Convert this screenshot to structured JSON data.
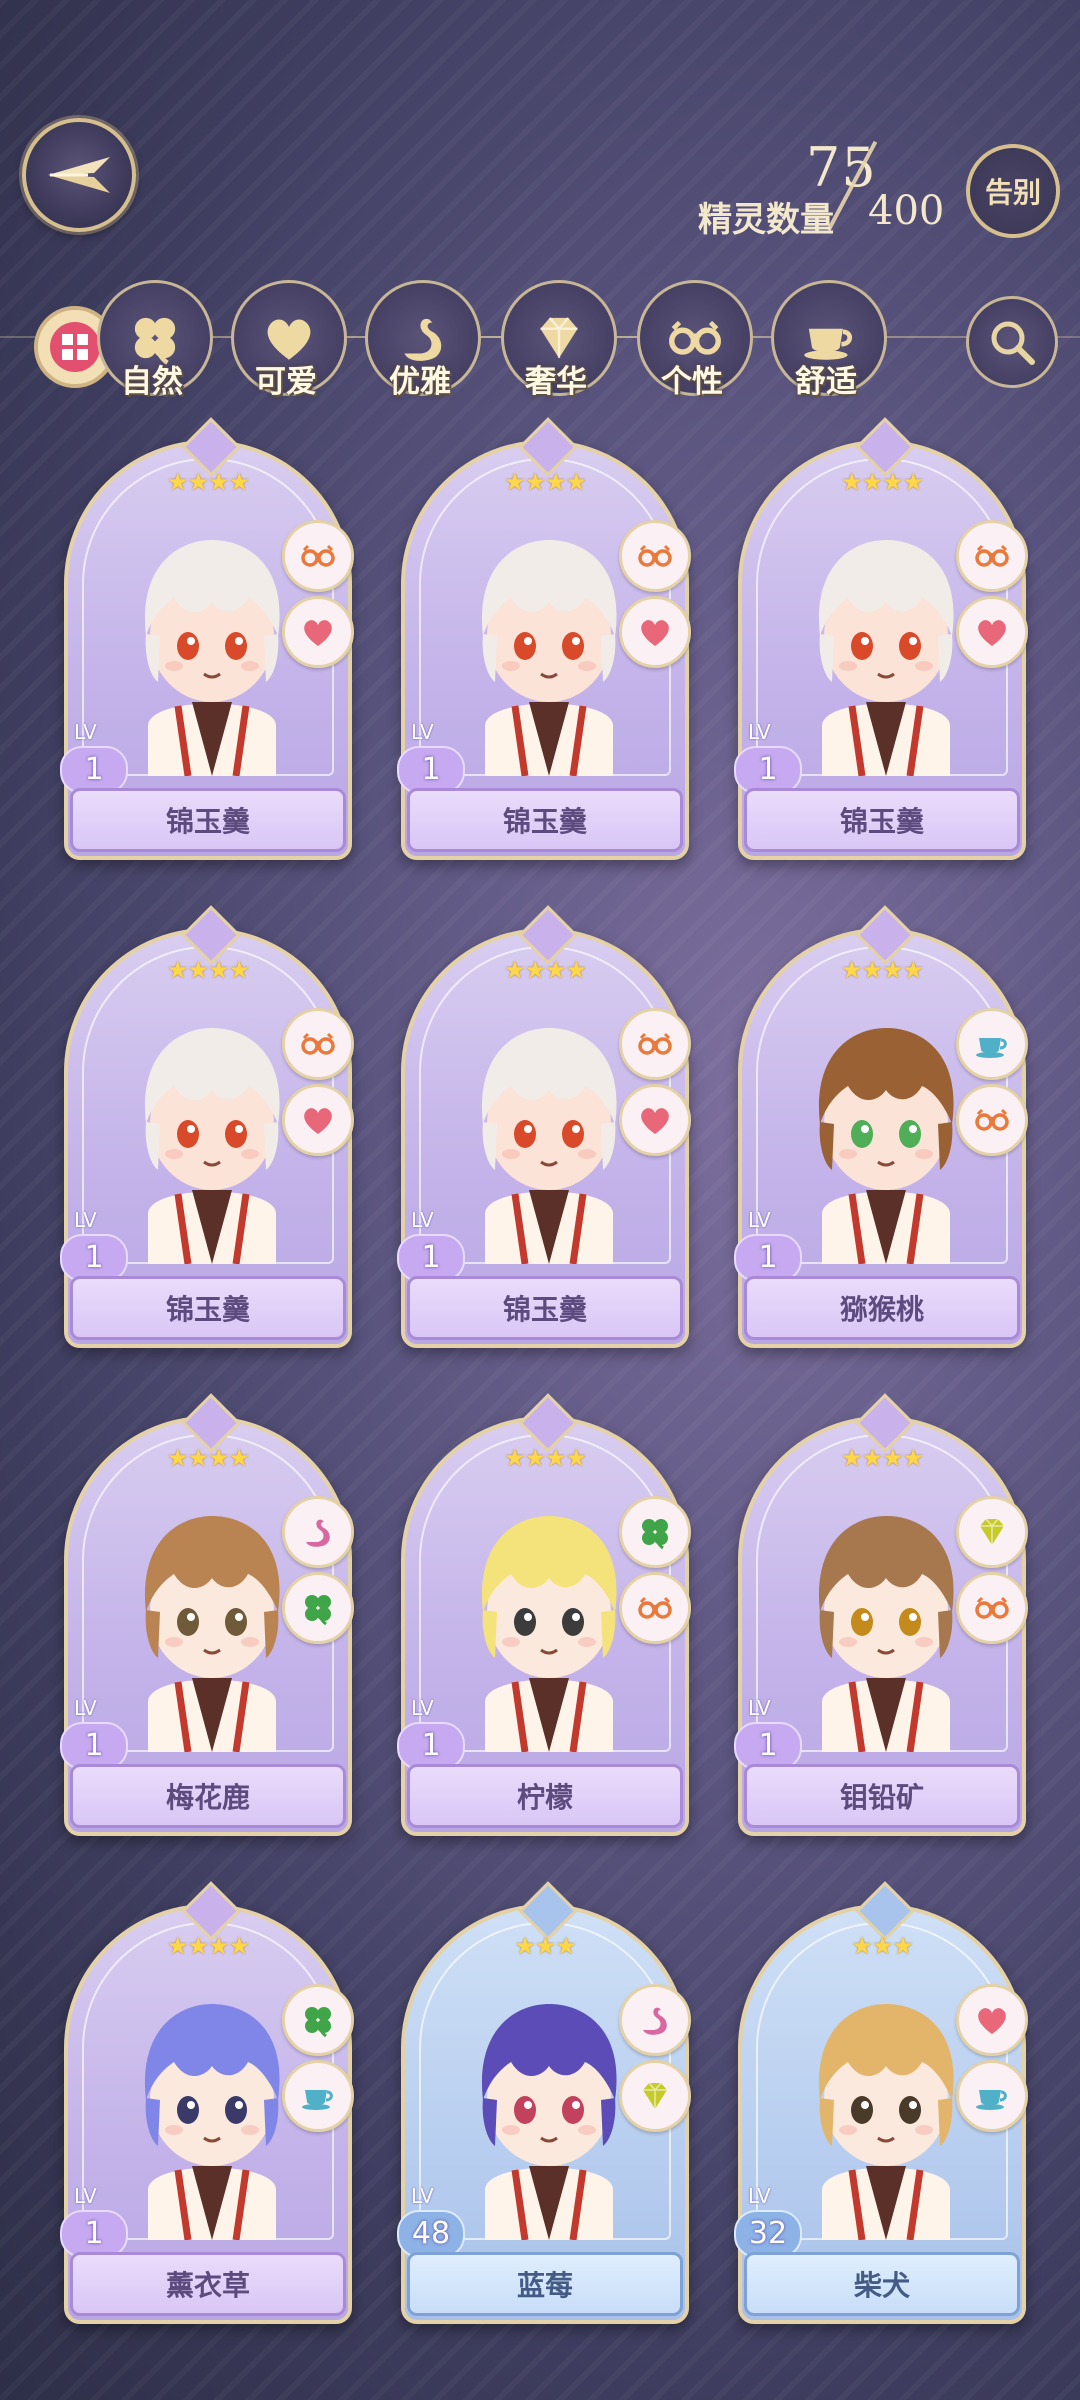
{
  "header": {
    "spirit_count": "75",
    "spirit_max": "400",
    "spirit_label": "精灵数量",
    "farewell_label": "告别"
  },
  "filters": [
    {
      "label": "自然",
      "icon": "clover-icon"
    },
    {
      "label": "可爱",
      "icon": "heart-icon"
    },
    {
      "label": "优雅",
      "icon": "swan-icon"
    },
    {
      "label": "奢华",
      "icon": "diamond-icon"
    },
    {
      "label": "个性",
      "icon": "glasses-icon"
    },
    {
      "label": "舒适",
      "icon": "teacup-icon"
    }
  ],
  "cards": [
    {
      "name": "锦玉羹",
      "lv_label": "LV",
      "level": "1",
      "stars": "★★★★",
      "theme": "purple",
      "traits": [
        "glasses-icon",
        "heart-icon"
      ],
      "hair": "#f2ece8",
      "eyes": "#d84a2a",
      "skin": "#fbe3d8"
    },
    {
      "name": "锦玉羹",
      "lv_label": "LV",
      "level": "1",
      "stars": "★★★★",
      "theme": "purple",
      "traits": [
        "glasses-icon",
        "heart-icon"
      ],
      "hair": "#f2ece8",
      "eyes": "#d84a2a",
      "skin": "#fbe3d8"
    },
    {
      "name": "锦玉羹",
      "lv_label": "LV",
      "level": "1",
      "stars": "★★★★",
      "theme": "purple",
      "traits": [
        "glasses-icon",
        "heart-icon"
      ],
      "hair": "#f2ece8",
      "eyes": "#d84a2a",
      "skin": "#fbe3d8"
    },
    {
      "name": "锦玉羹",
      "lv_label": "LV",
      "level": "1",
      "stars": "★★★★",
      "theme": "purple",
      "traits": [
        "glasses-icon",
        "heart-icon"
      ],
      "hair": "#f2ece8",
      "eyes": "#d84a2a",
      "skin": "#fbe3d8"
    },
    {
      "name": "锦玉羹",
      "lv_label": "LV",
      "level": "1",
      "stars": "★★★★",
      "theme": "purple",
      "traits": [
        "glasses-icon",
        "heart-icon"
      ],
      "hair": "#f2ece8",
      "eyes": "#d84a2a",
      "skin": "#fbe3d8"
    },
    {
      "name": "猕猴桃",
      "lv_label": "LV",
      "level": "1",
      "stars": "★★★★",
      "theme": "purple",
      "traits": [
        "teacup-icon",
        "glasses-icon"
      ],
      "hair": "#9a6134",
      "eyes": "#4fae57",
      "skin": "#fbe3d8"
    },
    {
      "name": "梅花鹿",
      "lv_label": "LV",
      "level": "1",
      "stars": "★★★★",
      "theme": "purple",
      "traits": [
        "swan-icon",
        "clover-icon"
      ],
      "hair": "#b98452",
      "eyes": "#6f5a3a",
      "skin": "#fbe9dd"
    },
    {
      "name": "柠檬",
      "lv_label": "LV",
      "level": "1",
      "stars": "★★★★",
      "theme": "purple",
      "traits": [
        "clover-icon",
        "glasses-icon"
      ],
      "hair": "#f4e37a",
      "eyes": "#3c3c3c",
      "skin": "#fbe9dd"
    },
    {
      "name": "钼铅矿",
      "lv_label": "LV",
      "level": "1",
      "stars": "★★★★",
      "theme": "purple",
      "traits": [
        "diamond-icon",
        "glasses-icon"
      ],
      "hair": "#a7784d",
      "eyes": "#c48a1c",
      "skin": "#fbe9dd"
    },
    {
      "name": "薰衣草",
      "lv_label": "LV",
      "level": "1",
      "stars": "★★★★",
      "theme": "purple",
      "traits": [
        "clover-icon",
        "teacup-icon"
      ],
      "hair": "#7f86e8",
      "eyes": "#3a3a6a",
      "skin": "#fbe9dd"
    },
    {
      "name": "蓝莓",
      "lv_label": "LV",
      "level": "48",
      "stars": "★★★",
      "theme": "blue",
      "traits": [
        "swan-icon",
        "diamond-icon"
      ],
      "hair": "#5b4cb8",
      "eyes": "#c2425d",
      "skin": "#fbe9dd"
    },
    {
      "name": "柴犬",
      "lv_label": "LV",
      "level": "32",
      "stars": "★★★",
      "theme": "blue",
      "traits": [
        "heart-icon",
        "teacup-icon"
      ],
      "hair": "#e2b56a",
      "eyes": "#4a3a2a",
      "skin": "#fbe9dd"
    }
  ],
  "colors": {
    "gold_trim": "#e4d2a6",
    "purple_card": "#c4b4ea",
    "blue_card": "#b9cff0",
    "star": "#ffd84a",
    "trait_red": "#e86a7a"
  }
}
